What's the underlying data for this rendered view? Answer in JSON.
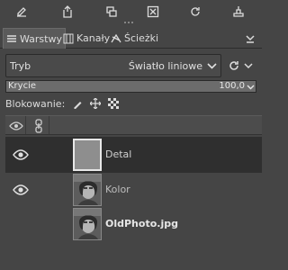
{
  "toolbar": {
    "buttons": [
      "new-layer-icon",
      "raise-layer-icon",
      "duplicate-layer-icon",
      "delete-layer-icon",
      "reset-icon",
      "anchor-icon"
    ]
  },
  "tabs": [
    {
      "label": "Warstwy",
      "icon": "layers-icon",
      "active": true
    },
    {
      "label": "Kanały",
      "icon": "channels-icon",
      "active": false
    },
    {
      "label": "Ścieżki",
      "icon": "paths-icon",
      "active": false
    }
  ],
  "mode": {
    "label": "Tryb",
    "value": "Światło liniowe"
  },
  "opacity": {
    "label": "Krycie",
    "value": "100,0",
    "fraction": 1.0
  },
  "lock": {
    "label": "Blokowanie:"
  },
  "layers": [
    {
      "name": "Detal",
      "visible": true,
      "selected": true,
      "thumb": "gray"
    },
    {
      "name": "Kolor",
      "visible": true,
      "selected": false,
      "thumb": "photo"
    },
    {
      "name": "OldPhoto.jpg",
      "visible": false,
      "selected": false,
      "thumb": "photo"
    }
  ]
}
